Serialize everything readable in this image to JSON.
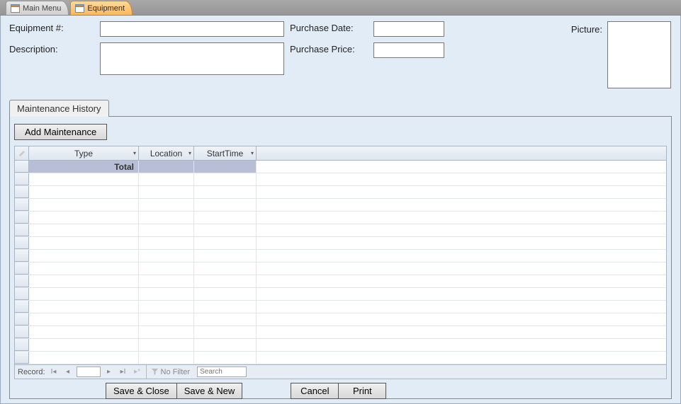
{
  "tabs": {
    "main_menu": "Main Menu",
    "equipment": "Equipment"
  },
  "form": {
    "equipment_num_label": "Equipment #:",
    "equipment_num_value": "",
    "description_label": "Description:",
    "description_value": "",
    "purchase_date_label": "Purchase Date:",
    "purchase_date_value": "",
    "purchase_price_label": "Purchase Price:",
    "purchase_price_value": "",
    "picture_label": "Picture:"
  },
  "subtab": {
    "label": "Maintenance History",
    "add_btn": "Add Maintenance",
    "columns": {
      "type": "Type",
      "location": "Location",
      "starttime": "StartTime"
    },
    "total_label": "Total"
  },
  "recordnav": {
    "label": "Record:",
    "current": "",
    "no_filter": "No Filter",
    "search_placeholder": "Search"
  },
  "buttons": {
    "save_close": "Save & Close",
    "save_new": "Save & New",
    "cancel": "Cancel",
    "print": "Print"
  }
}
